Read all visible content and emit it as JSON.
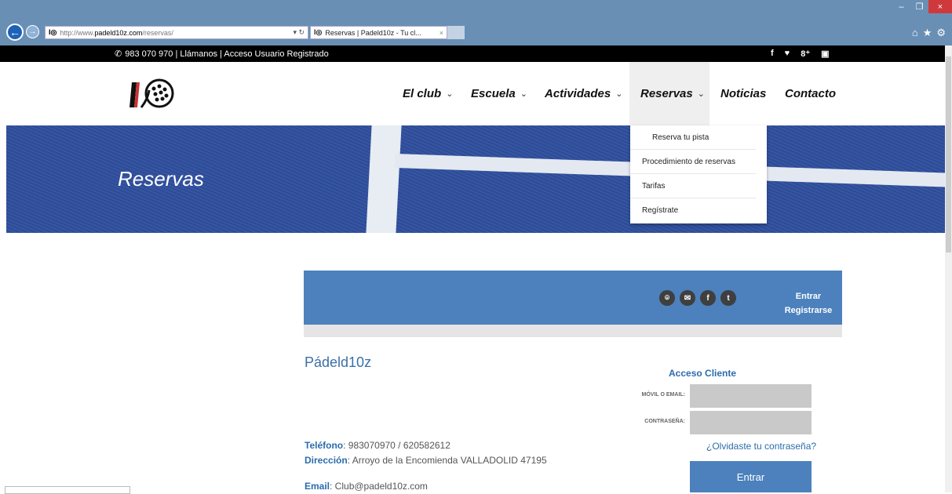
{
  "browser": {
    "address_prefix": "http://www.",
    "address_host": "padeld10z.com",
    "address_path": "/reservas/",
    "tab_title": "Reservas | Padeld10z - Tu cl...",
    "tab_close": "×",
    "window_controls": [
      "–",
      "❐",
      "×"
    ],
    "toolbar_icons": [
      "home-icon",
      "star-icon",
      "gear-icon"
    ]
  },
  "topbar": {
    "text": "983 070 970 | Llámanos | Acceso Usuario Registrado",
    "social": [
      "f",
      "t",
      "g+",
      "yt"
    ]
  },
  "nav": {
    "items": [
      {
        "label": "El club",
        "dropdown": true
      },
      {
        "label": "Escuela",
        "dropdown": true
      },
      {
        "label": "Actividades",
        "dropdown": true
      },
      {
        "label": "Reservas",
        "dropdown": true,
        "active": true
      },
      {
        "label": "Noticias",
        "dropdown": false
      },
      {
        "label": "Contacto",
        "dropdown": false
      }
    ],
    "chevron": "⌵"
  },
  "hero": {
    "title": "Reservas"
  },
  "dropdown": {
    "items": [
      "Reserva tu pista",
      "Procedimiento de reservas",
      "Tarifas",
      "Regístrate"
    ]
  },
  "widget": {
    "icons": [
      "location-icon",
      "mail-icon",
      "facebook-icon",
      "twitter-icon"
    ],
    "login_link": "Entrar",
    "register_link": "Registrarse",
    "club_name": "Pádeld10z",
    "phone_label": "Teléfono",
    "phone_value": ": 983070970 / 620582612",
    "address_label": "Dirección",
    "address_value": ": Arroyo de la Encomienda  VALLADOLID 47195",
    "email_label": "Email",
    "email_value": ": Club@padeld10z.com"
  },
  "login": {
    "title": "Acceso Cliente",
    "user_label": "MÓVIL O EMAIL:",
    "password_label": "CONTRASEÑA:",
    "forgot": "¿Olvidaste tu contraseña?",
    "submit": "Entrar"
  },
  "colors": {
    "accent": "#4c81bd",
    "link": "#2b6cad",
    "hero": "#2f4f9e"
  }
}
